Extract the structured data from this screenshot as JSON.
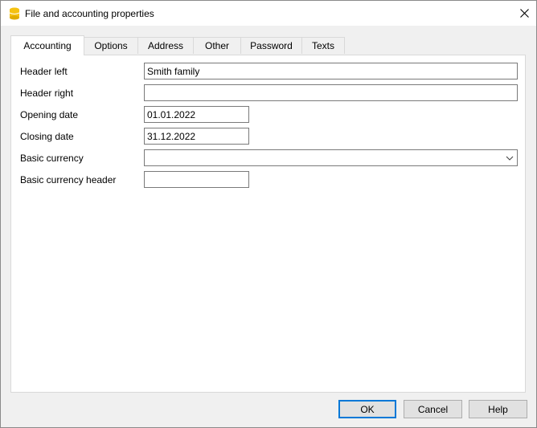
{
  "window": {
    "title": "File and accounting properties"
  },
  "tabs": [
    {
      "label": "Accounting",
      "active": true
    },
    {
      "label": "Options"
    },
    {
      "label": "Address"
    },
    {
      "label": "Other"
    },
    {
      "label": "Password"
    },
    {
      "label": "Texts"
    }
  ],
  "form": {
    "header_left": {
      "label": "Header left",
      "value": "Smith family"
    },
    "header_right": {
      "label": "Header right",
      "value": ""
    },
    "opening_date": {
      "label": "Opening date",
      "value": "01.01.2022"
    },
    "closing_date": {
      "label": "Closing date",
      "value": "31.12.2022"
    },
    "basic_currency": {
      "label": "Basic currency",
      "value": ""
    },
    "basic_currency_header": {
      "label": "Basic currency header",
      "value": ""
    }
  },
  "buttons": {
    "ok": "OK",
    "cancel": "Cancel",
    "help": "Help"
  },
  "icons": {
    "app": "database-icon",
    "close": "close-icon",
    "dropdown": "chevron-down-icon"
  },
  "colors": {
    "app_icon": "#f5c211",
    "focus_border": "#0078d7"
  }
}
